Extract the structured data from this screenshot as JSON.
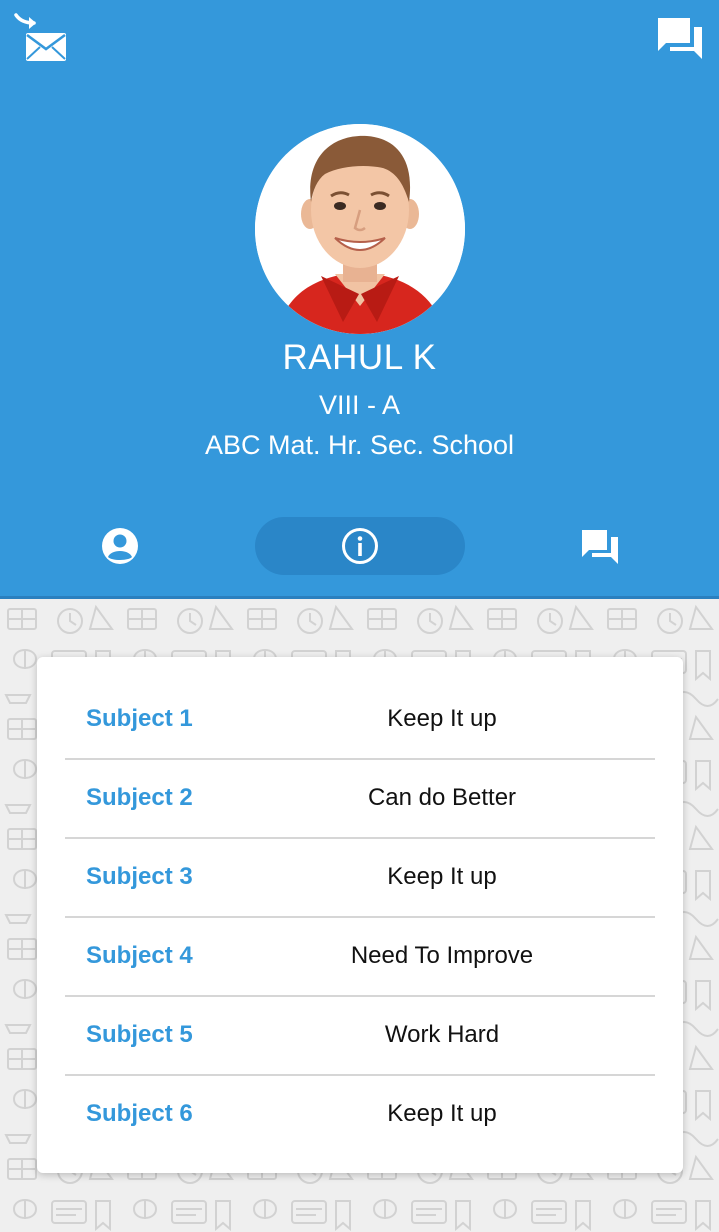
{
  "colors": {
    "header_bg": "#3498db",
    "accent": "#3498db",
    "active_tab_bg": "#2a86c8",
    "card_bg": "#ffffff",
    "text_dark": "#111111"
  },
  "header": {
    "left_icon": "mail-forward-icon",
    "right_icon": "chat-bubbles-icon"
  },
  "student": {
    "name": "RAHUL K",
    "class": "VIII - A",
    "school": "ABC Mat. Hr. Sec. School"
  },
  "tabs": [
    {
      "icon": "account-circle-icon",
      "active": false
    },
    {
      "icon": "info-icon",
      "active": true
    },
    {
      "icon": "chat-bubbles-icon",
      "active": false
    }
  ],
  "remarks": [
    {
      "subject": "Subject 1",
      "remark": "Keep It up"
    },
    {
      "subject": "Subject 2",
      "remark": "Can do Better"
    },
    {
      "subject": "Subject 3",
      "remark": "Keep It up"
    },
    {
      "subject": "Subject 4",
      "remark": "Need To Improve"
    },
    {
      "subject": "Subject 5",
      "remark": "Work Hard"
    },
    {
      "subject": "Subject 6",
      "remark": "Keep It up"
    }
  ]
}
